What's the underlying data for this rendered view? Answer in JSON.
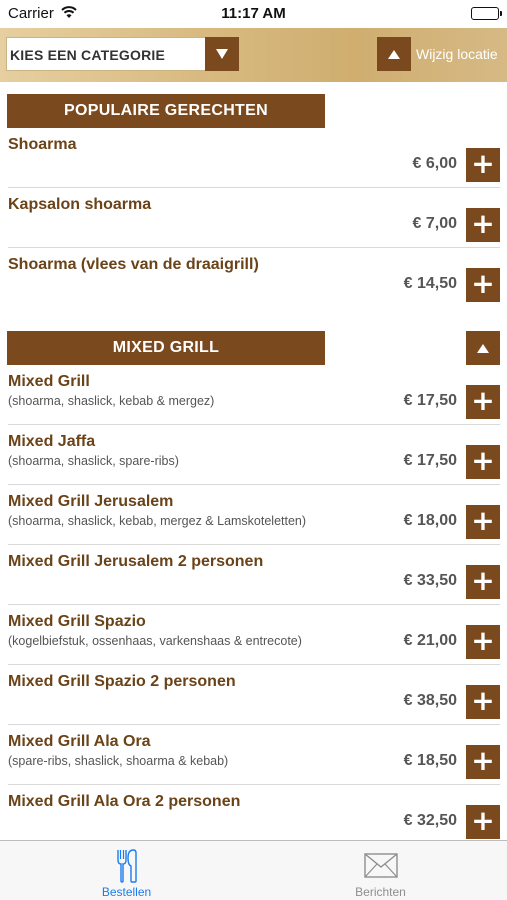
{
  "status_bar": {
    "carrier": "Carrier",
    "time": "11:17 AM"
  },
  "header": {
    "category_placeholder": "KIES EEN CATEGORIE",
    "location_label": "Wijzig locatie"
  },
  "sections": [
    {
      "title": "POPULAIRE GERECHTEN",
      "items": [
        {
          "name": "Shoarma",
          "desc": "",
          "price": "€ 6,00"
        },
        {
          "name": "Kapsalon shoarma",
          "desc": "",
          "price": "€ 7,00"
        },
        {
          "name": "Shoarma (vlees van de draaigrill)",
          "desc": "",
          "price": "€ 14,50"
        }
      ]
    },
    {
      "title": "MIXED GRILL",
      "items": [
        {
          "name": "Mixed Grill",
          "desc": "(shoarma, shaslick, kebab & mergez)",
          "price": "€ 17,50"
        },
        {
          "name": "Mixed Jaffa",
          "desc": "(shoarma, shaslick, spare-ribs)",
          "price": "€ 17,50"
        },
        {
          "name": "Mixed Grill Jerusalem",
          "desc": "(shoarma, shaslick, kebab, mergez & Lamskoteletten)",
          "price": "€ 18,00"
        },
        {
          "name": "Mixed Grill Jerusalem 2 personen",
          "desc": "",
          "price": "€ 33,50"
        },
        {
          "name": "Mixed Grill Spazio",
          "desc": "(kogelbiefstuk, ossenhaas, varkenshaas & entrecote)",
          "price": "€ 21,00"
        },
        {
          "name": "Mixed Grill Spazio 2 personen",
          "desc": "",
          "price": "€ 38,50"
        },
        {
          "name": "Mixed Grill Ala Ora",
          "desc": "(spare-ribs, shaslick, shoarma & kebab)",
          "price": "€ 18,50"
        },
        {
          "name": "Mixed Grill Ala Ora 2 personen",
          "desc": "",
          "price": "€ 32,50"
        }
      ]
    }
  ],
  "tabbar": {
    "tabs": [
      {
        "label": "Bestellen",
        "icon": "fork-knife-icon",
        "active": true
      },
      {
        "label": "Berichten",
        "icon": "envelope-icon",
        "active": false
      }
    ]
  },
  "colors": {
    "brand": "#7a4a1e",
    "accent": "#1a7cf0",
    "item_name": "#6b4318"
  }
}
